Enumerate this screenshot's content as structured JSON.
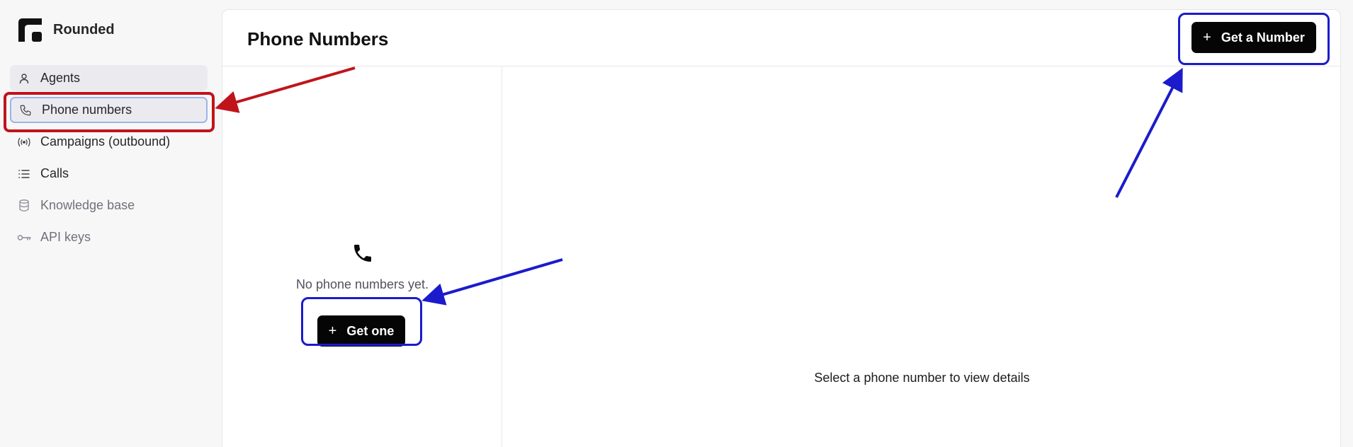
{
  "brand": {
    "name": "Rounded"
  },
  "sidebar": {
    "items": [
      {
        "label": "Agents",
        "icon": "user-icon"
      },
      {
        "label": "Phone numbers",
        "icon": "phone-icon"
      },
      {
        "label": "Campaigns (outbound)",
        "icon": "broadcast-icon"
      },
      {
        "label": "Calls",
        "icon": "list-icon"
      },
      {
        "label": "Knowledge base",
        "icon": "database-icon"
      },
      {
        "label": "API keys",
        "icon": "key-icon"
      }
    ]
  },
  "header": {
    "title": "Phone Numbers",
    "get_number_label": "Get a Number"
  },
  "list": {
    "empty_text": "No phone numbers yet.",
    "get_one_label": "Get one"
  },
  "detail": {
    "placeholder": "Select a phone number to view details"
  },
  "colors": {
    "annotation_red": "#c0141b",
    "annotation_blue": "#1b1bcc",
    "active_border": "#9db4e6"
  }
}
